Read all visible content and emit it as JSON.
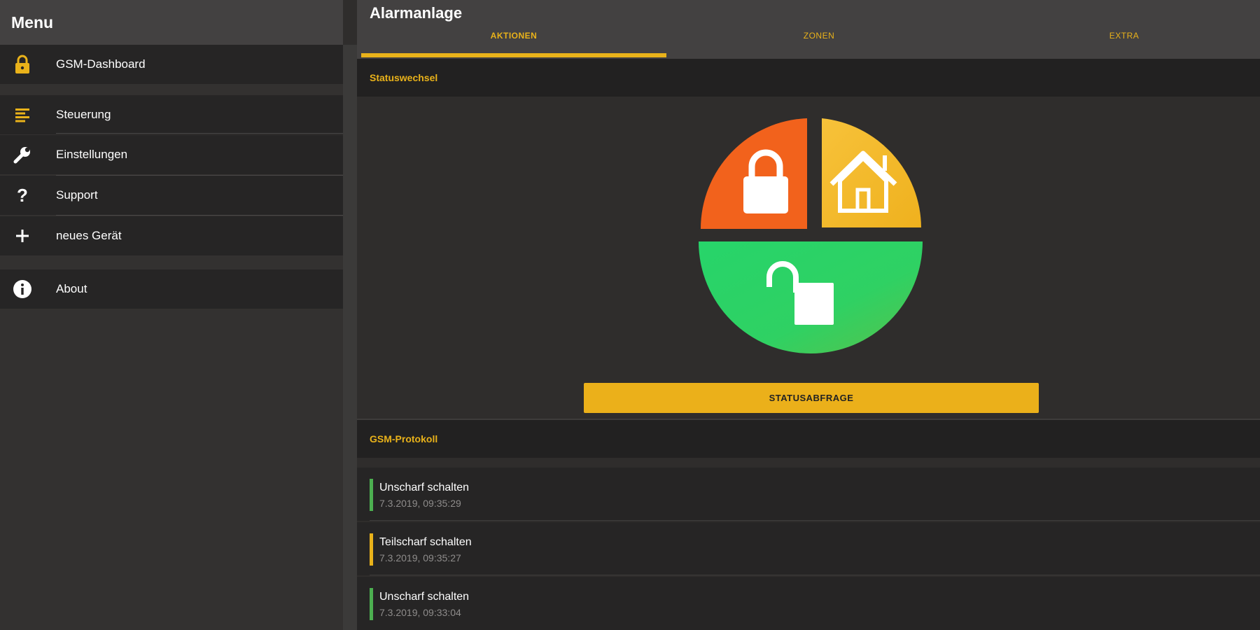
{
  "sidebar": {
    "title": "Menu",
    "items": [
      {
        "label": "GSM-Dashboard",
        "icon": "lock-icon"
      },
      {
        "label": "Steuerung",
        "icon": "list-icon"
      },
      {
        "label": "Einstellungen",
        "icon": "wrench-icon"
      },
      {
        "label": "Support",
        "icon": "help-icon"
      },
      {
        "label": "neues Gerät",
        "icon": "plus-icon"
      },
      {
        "label": "About",
        "icon": "info-icon"
      }
    ]
  },
  "appbar": {
    "title": "Alarmanlage",
    "tabs": [
      {
        "label": "AKTIONEN",
        "active": true
      },
      {
        "label": "ZONEN",
        "active": false
      },
      {
        "label": "EXTRA",
        "active": false
      }
    ]
  },
  "status": {
    "header": "Statuswechsel",
    "button_label": "STATUSABFRAGE",
    "segments": [
      {
        "name": "scharf",
        "icon": "padlock-closed-icon",
        "color": "#f2621c"
      },
      {
        "name": "teilscharf",
        "icon": "home-icon",
        "color": "#f3be2a"
      },
      {
        "name": "unscharf",
        "icon": "padlock-open-icon",
        "color": "#2fd163"
      }
    ]
  },
  "protocol": {
    "header": "GSM-Protokoll",
    "entries": [
      {
        "title": "Unscharf schalten",
        "time": "7.3.2019, 09:35:29",
        "color": "#4caf50"
      },
      {
        "title": "Teilscharf schalten",
        "time": "7.3.2019, 09:35:27",
        "color": "#e9b21a"
      },
      {
        "title": "Unscharf schalten",
        "time": "7.3.2019, 09:33:04",
        "color": "#4caf50"
      }
    ]
  },
  "colors": {
    "accent": "#e9b21a",
    "background": "#2f2d2c",
    "surface": "#262525"
  }
}
